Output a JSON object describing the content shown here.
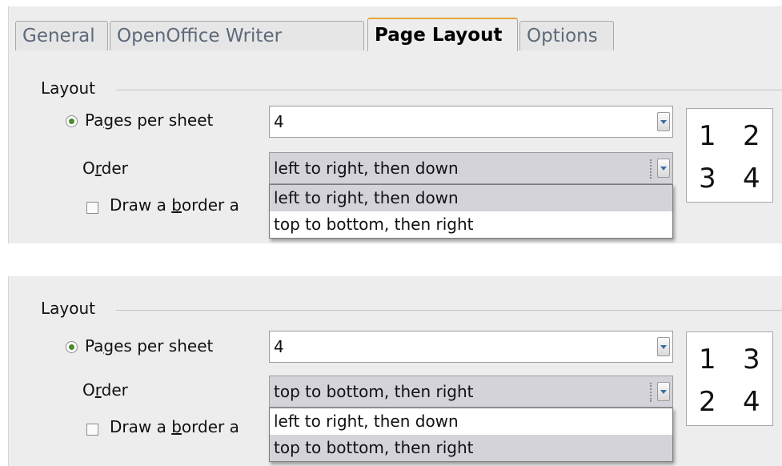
{
  "tabs": [
    {
      "label": "General"
    },
    {
      "label": "OpenOffice Writer"
    },
    {
      "label": "Page Layout",
      "active": true
    },
    {
      "label": "Options"
    }
  ],
  "panels": [
    {
      "group_title": "Layout",
      "pages_label_pre": "Pa",
      "pages_label_u": "g",
      "pages_label_post": "es per sheet",
      "pages_value": "4",
      "order_label_pre": "O",
      "order_label_u": "r",
      "order_label_post": "der",
      "order_value": "left to right, then down",
      "border_label_pre": "Draw a ",
      "border_label_u": "b",
      "border_label_post": "order a",
      "options": [
        "left to right, then down",
        "top to bottom, then right"
      ],
      "highlighted_option": 0,
      "preview": [
        "1",
        "2",
        "3",
        "4"
      ]
    },
    {
      "group_title": "Layout",
      "pages_label_pre": "Pa",
      "pages_label_u": "g",
      "pages_label_post": "es per sheet",
      "pages_value": "4",
      "order_label_pre": "O",
      "order_label_u": "r",
      "order_label_post": "der",
      "order_value": "top to bottom, then right",
      "border_label_pre": "Draw a ",
      "border_label_u": "b",
      "border_label_post": "order a",
      "options": [
        "left to right, then down",
        "top to bottom, then right"
      ],
      "highlighted_option": 1,
      "preview": [
        "1",
        "3",
        "2",
        "4"
      ]
    }
  ],
  "colors": {
    "active_tab_accent": "#e8a53a",
    "radio_dot": "#4b8a2a",
    "highlight": "#d4d3da"
  }
}
